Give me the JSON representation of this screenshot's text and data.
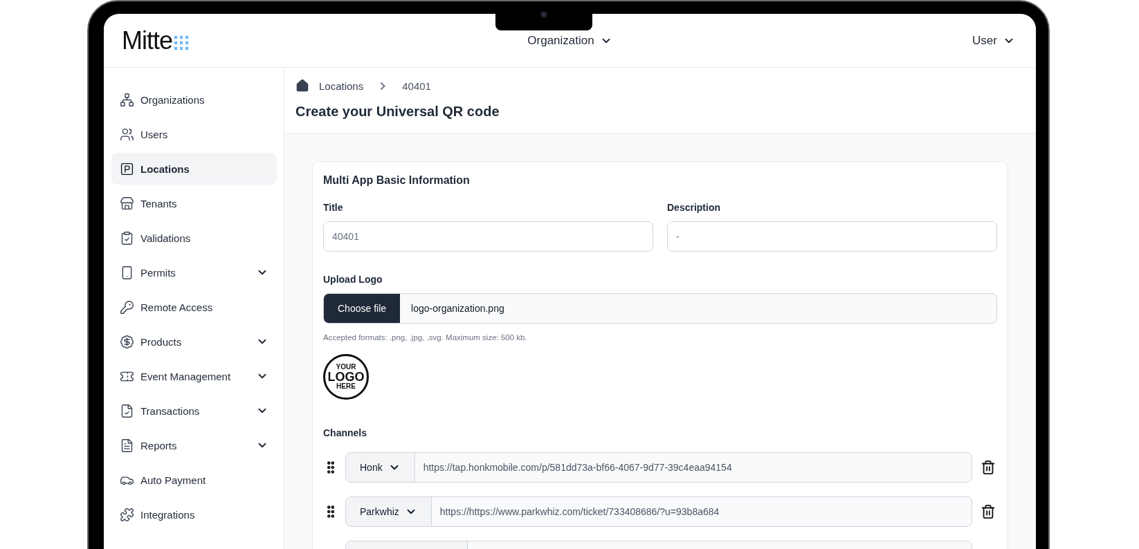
{
  "brand": {
    "name": "Mitte"
  },
  "header": {
    "organization_menu": "Organization",
    "user_menu": "User"
  },
  "sidebar": {
    "items": [
      {
        "label": "Organizations",
        "selected": false,
        "has_submenu": false
      },
      {
        "label": "Users",
        "selected": false,
        "has_submenu": false
      },
      {
        "label": "Locations",
        "selected": true,
        "has_submenu": false
      },
      {
        "label": "Tenants",
        "selected": false,
        "has_submenu": false
      },
      {
        "label": "Validations",
        "selected": false,
        "has_submenu": false
      },
      {
        "label": "Permits",
        "selected": false,
        "has_submenu": true
      },
      {
        "label": "Remote Access",
        "selected": false,
        "has_submenu": false
      },
      {
        "label": "Products",
        "selected": false,
        "has_submenu": true
      },
      {
        "label": "Event Management",
        "selected": false,
        "has_submenu": true
      },
      {
        "label": "Transactions",
        "selected": false,
        "has_submenu": true
      },
      {
        "label": "Reports",
        "selected": false,
        "has_submenu": true
      },
      {
        "label": "Auto Payment",
        "selected": false,
        "has_submenu": false
      },
      {
        "label": "Integrations",
        "selected": false,
        "has_submenu": false
      }
    ]
  },
  "breadcrumb": [
    "Locations",
    "40401"
  ],
  "page_title": "Create your Universal QR code",
  "form": {
    "section_title": "Multi App Basic Information",
    "fields": [
      {
        "label": "Title",
        "placeholder": "40401"
      },
      {
        "label": "Description",
        "placeholder": "-"
      }
    ],
    "upload": {
      "label": "Upload Logo",
      "button": "Choose file",
      "file_name": "logo-organization.png",
      "hint": "Accepted formats: .png, .jpg, .svg. Maximum size: 500 kb."
    },
    "logo_preview": [
      "YOUR",
      "LOGO",
      "HERE"
    ],
    "channels_title": "Channels",
    "channels": [
      {
        "kind": "filled",
        "app": "Honk",
        "url": "https://tap.honkmobile.com/p/581dd73a-bf66-4067-9d77-39c4eaa94154"
      },
      {
        "kind": "filled",
        "app": "Parkwhiz",
        "url": "https://https://www.parkwhiz.com/ticket/733408686/?u=93b8a684"
      },
      {
        "kind": "blank"
      }
    ]
  }
}
